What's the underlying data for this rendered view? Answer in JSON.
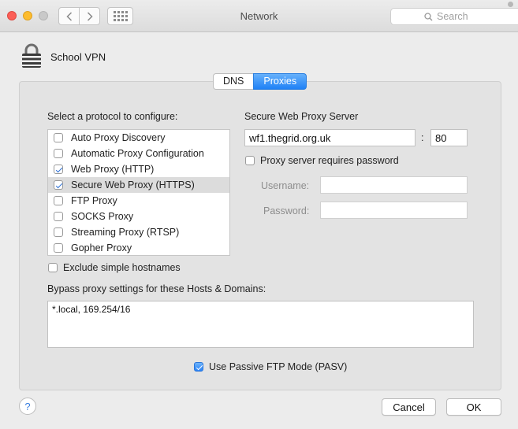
{
  "window": {
    "title": "Network"
  },
  "search": {
    "placeholder": "Search"
  },
  "service": {
    "name": "School VPN"
  },
  "tabs": [
    {
      "label": "DNS",
      "selected": false
    },
    {
      "label": "Proxies",
      "selected": true
    }
  ],
  "protocols": {
    "heading": "Select a protocol to configure:",
    "items": [
      {
        "label": "Auto Proxy Discovery",
        "checked": false
      },
      {
        "label": "Automatic Proxy Configuration",
        "checked": false
      },
      {
        "label": "Web Proxy (HTTP)",
        "checked": true
      },
      {
        "label": "Secure Web Proxy (HTTPS)",
        "checked": true,
        "selected": true
      },
      {
        "label": "FTP Proxy",
        "checked": false
      },
      {
        "label": "SOCKS Proxy",
        "checked": false
      },
      {
        "label": "Streaming Proxy (RTSP)",
        "checked": false
      },
      {
        "label": "Gopher Proxy",
        "checked": false
      }
    ]
  },
  "exclude_simple": {
    "label": "Exclude simple hostnames",
    "checked": false
  },
  "server": {
    "heading": "Secure Web Proxy Server",
    "host": "wf1.thegrid.org.uk",
    "separator": ":",
    "port": "80",
    "requires_password": {
      "label": "Proxy server requires password",
      "checked": false
    },
    "username_label": "Username:",
    "password_label": "Password:"
  },
  "bypass": {
    "label": "Bypass proxy settings for these Hosts & Domains:",
    "value": "*.local, 169.254/16"
  },
  "passive_ftp": {
    "label": "Use Passive FTP Mode (PASV)",
    "checked": true
  },
  "buttons": {
    "help": "?",
    "cancel": "Cancel",
    "ok": "OK"
  },
  "colors": {
    "accent": "#1f81f6",
    "selection": "#dcdcdc"
  }
}
